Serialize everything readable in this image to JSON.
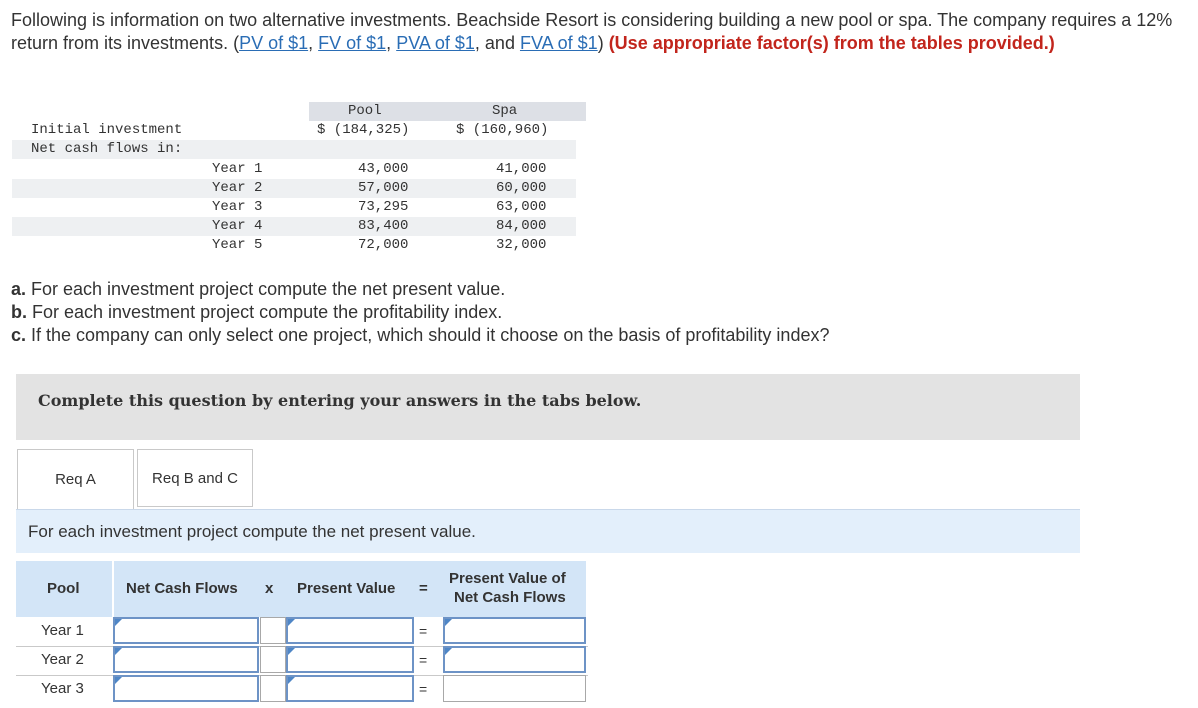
{
  "intro": {
    "text1": "Following is information on two alternative investments. Beachside Resort is considering building a new pool or spa. The company requires a 12% return from its investments. (",
    "links": [
      "PV of $1",
      "FV of $1",
      "PVA of $1",
      "FVA of $1"
    ],
    "sep1": ", ",
    "sep2": ", ",
    "sep3": ", and ",
    "close": ") ",
    "red": "(Use appropriate factor(s) from the tables provided.)"
  },
  "data_table": {
    "col_pool": "Pool",
    "col_spa": "Spa",
    "initial_label": "Initial investment",
    "initial_pool": "$ (184,325)",
    "initial_spa": "$ (160,960)",
    "ncf_label": "Net cash flows in:",
    "years": [
      {
        "label": "Year 1",
        "pool": "43,000",
        "spa": "41,000"
      },
      {
        "label": "Year 2",
        "pool": "57,000",
        "spa": "60,000"
      },
      {
        "label": "Year 3",
        "pool": "73,295",
        "spa": "63,000"
      },
      {
        "label": "Year 4",
        "pool": "83,400",
        "spa": "84,000"
      },
      {
        "label": "Year 5",
        "pool": "72,000",
        "spa": "32,000"
      }
    ]
  },
  "questions": {
    "a_letter": "a.",
    "a_text": " For each investment project compute the net present value.",
    "b_letter": "b.",
    "b_text": " For each investment project compute the profitability index.",
    "c_letter": "c.",
    "c_text": " If the company can only select one project, which should it choose on the basis of profitability index?"
  },
  "banner": "Complete this question by entering your answers in the tabs below.",
  "tabs": [
    "Req A",
    "Req B and C"
  ],
  "instruction": "For each investment project compute the net present value.",
  "answer_table": {
    "h_pool": "Pool",
    "h_ncf": "Net Cash Flows",
    "h_x": "x",
    "h_pv": "Present Value",
    "h_eq": "=",
    "h_pvncf_1": "Present Value of",
    "h_pvncf_2": "Net Cash Flows",
    "rows": [
      {
        "label": "Year 1",
        "eq": "="
      },
      {
        "label": "Year 2",
        "eq": "="
      },
      {
        "label": "Year 3",
        "eq": "="
      }
    ]
  }
}
